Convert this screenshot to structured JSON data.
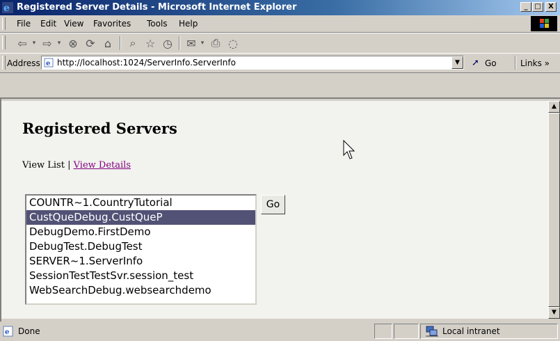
{
  "window": {
    "title": "Registered Server Details - Microsoft Internet Explorer",
    "minimize": "_",
    "maximize": "□",
    "close": "X"
  },
  "menu": [
    "File",
    "Edit",
    "View",
    "Favorites",
    "Tools",
    "Help"
  ],
  "toolbar": {
    "icons": [
      "back-icon",
      "forward-icon",
      "stop-icon",
      "refresh-icon",
      "home-icon",
      "search-icon",
      "favorites-icon",
      "history-icon",
      "mail-icon",
      "print-icon",
      "discuss-icon"
    ]
  },
  "address_bar": {
    "label": "Address",
    "url": "http://localhost:1024/ServerInfo.ServerInfo",
    "go_label": "Go",
    "links_label": "Links »"
  },
  "page": {
    "title": "Registered Servers",
    "view_list": "View List",
    "separator": "|",
    "view_details": "View Details",
    "go_button": "Go",
    "servers": [
      "COUNTR~1.CountryTutorial",
      "CustQueDebug.CustQueP",
      "DebugDemo.FirstDemo",
      "DebugTest.DebugTest",
      "SERVER~1.ServerInfo",
      "SessionTestTestSvr.session_test",
      "WebSearchDebug.websearchdemo"
    ],
    "selected_index": 1
  },
  "status": {
    "text": "Done",
    "zone": "Local intranet"
  },
  "colors": {
    "title_gradient_start": "#0a246a",
    "selection": "#525276",
    "visited_link": "#800080"
  }
}
